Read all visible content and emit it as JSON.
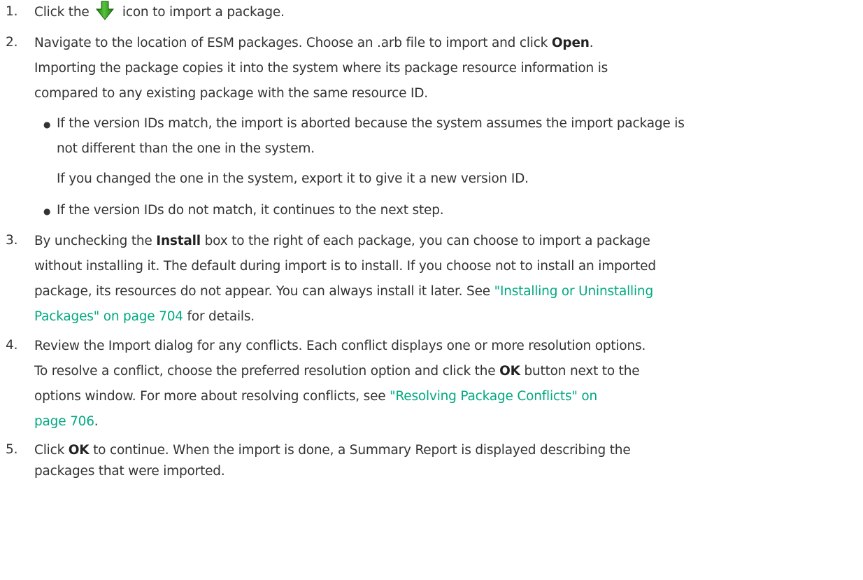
{
  "steps": [
    {
      "num": "1.",
      "pre": "Click the",
      "icon": "import-arrow-icon",
      "post": "icon to import a package."
    },
    {
      "num": "2.",
      "line1_pre": "Navigate to the location of ESM packages. Choose an .arb file to import and click ",
      "line1_bold": "Open",
      "line1_post": ".",
      "line2": "Importing the package copies it into the system where its package resource information is",
      "line3": "compared to any existing package with the same resource ID.",
      "bullets": [
        {
          "line1": "If the version IDs match, the import is aborted because the system assumes the import package is",
          "line2": "not different than the one in the system.",
          "note": "If you changed the one in the system, export it to give it a new version ID."
        },
        {
          "line1": "If the version IDs do not match, it continues to the next step."
        }
      ]
    },
    {
      "num": "3.",
      "l1_pre": "By unchecking the ",
      "l1_bold": "Install",
      "l1_post": " box to the right of each package, you can choose to import a package",
      "l2": "without installing it. The default during import is to install. If you choose not to install an imported",
      "l3_pre": "package, its resources do not appear. You can always install it later. See ",
      "l3_link": "\"Installing or Uninstalling",
      "l4_link": "Packages\" on page 704",
      "l4_post": " for details."
    },
    {
      "num": "4.",
      "l1": "Review the Import dialog for any conflicts. Each conflict displays one or more resolution options.",
      "l2_pre": "To resolve a conflict, choose the preferred resolution option and click the ",
      "l2_bold": "OK",
      "l2_post": " button next to the",
      "l3_pre": "options window. For more about resolving conflicts, see ",
      "l3_link": "\"Resolving Package Conflicts\" on",
      "l4_link": "page 706",
      "l4_post": "."
    },
    {
      "num": "5.",
      "l1_pre": "Click ",
      "l1_bold": "OK",
      "l1_post": " to continue. When the import is done, a Summary Report is displayed describing the",
      "l2": "packages that were imported."
    }
  ],
  "colors": {
    "text": "#333333",
    "link": "#01a982",
    "icon_green": "#2e9b1e"
  }
}
